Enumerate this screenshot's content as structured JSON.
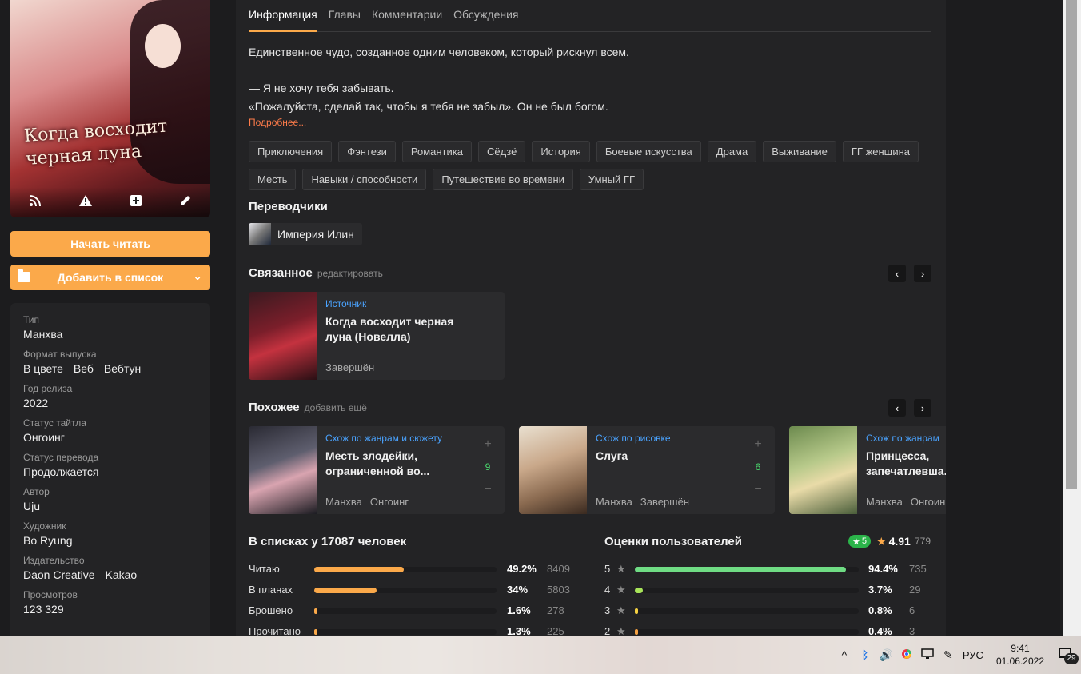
{
  "cover": {
    "title_art": "Когда восходит черная луна",
    "actions": [
      "rss-icon",
      "report-icon",
      "add-icon",
      "edit-icon"
    ]
  },
  "buttons": {
    "start_reading": "Начать читать",
    "add_to_list": "Добавить в список"
  },
  "info": [
    {
      "label": "Тип",
      "values": [
        "Манхва"
      ]
    },
    {
      "label": "Формат выпуска",
      "values": [
        "В цвете",
        "Веб",
        "Вебтун"
      ]
    },
    {
      "label": "Год релиза",
      "values": [
        "2022"
      ]
    },
    {
      "label": "Статус тайтла",
      "values": [
        "Онгоинг"
      ]
    },
    {
      "label": "Статус перевода",
      "values": [
        "Продолжается"
      ]
    },
    {
      "label": "Автор",
      "values": [
        "Uju"
      ]
    },
    {
      "label": "Художник",
      "values": [
        "Bo Ryung"
      ]
    },
    {
      "label": "Издательство",
      "values": [
        "Daon Creative",
        "Kakao"
      ]
    },
    {
      "label": "Просмотров",
      "values": [
        "123 329"
      ]
    }
  ],
  "tabs": [
    "Информация",
    "Главы",
    "Комментарии",
    "Обсуждения"
  ],
  "active_tab": 0,
  "description": {
    "lines": [
      "Единственное чудо, созданное одним человеком, который рискнул всем.",
      "",
      "— Я не хочу тебя забывать.",
      "«Пожалуйста, сделай так, чтобы я тебя не забыл». Он не был богом."
    ],
    "more": "Подробнее..."
  },
  "tags": [
    "Приключения",
    "Фэнтези",
    "Романтика",
    "Сёдзё",
    "История",
    "Боевые искусства",
    "Драма",
    "Выживание",
    "ГГ женщина",
    "Месть",
    "Навыки / способности",
    "Путешествие во времени",
    "Умный ГГ"
  ],
  "translators": {
    "title": "Переводчики",
    "items": [
      {
        "name": "Империя Илин"
      }
    ]
  },
  "related": {
    "title": "Связанное",
    "sub": "редактировать",
    "items": [
      {
        "relation": "Источник",
        "title": "Когда восходит черная луна (Новелла)",
        "meta": [
          "Завершён"
        ]
      }
    ]
  },
  "similar": {
    "title": "Похожее",
    "sub": "добавить ещё",
    "items": [
      {
        "relation": "Схож по жанрам и сюжету",
        "title": "Месть злодейки, ограниченной во...",
        "meta": [
          "Манхва",
          "Онгоинг"
        ],
        "votes": "9"
      },
      {
        "relation": "Схож по рисовке",
        "title": "Слуга",
        "meta": [
          "Манхва",
          "Завершён"
        ],
        "votes": "6"
      },
      {
        "relation": "Схож по жанрам",
        "title": "Принцесса, запечатлевша...",
        "meta": [
          "Манхва",
          "Онгоинг"
        ],
        "votes": ""
      }
    ]
  },
  "lists": {
    "title": "В списках у 17087 человек",
    "rows": [
      {
        "label": "Читаю",
        "pct": "49.2%",
        "count": "8409",
        "fraction": 0.492
      },
      {
        "label": "В планах",
        "pct": "34%",
        "count": "5803",
        "fraction": 0.34
      },
      {
        "label": "Брошено",
        "pct": "1.6%",
        "count": "278",
        "fraction": 0.016
      },
      {
        "label": "Прочитано",
        "pct": "1.3%",
        "count": "225",
        "fraction": 0.013
      }
    ],
    "color": "#fba94a"
  },
  "ratings": {
    "title": "Оценки пользователей",
    "badge": "5",
    "average": "4.91",
    "count": "779",
    "rows": [
      {
        "label": "5",
        "pct": "94.4%",
        "count": "735",
        "fraction": 0.944,
        "color": "#6fdc84"
      },
      {
        "label": "4",
        "pct": "3.7%",
        "count": "29",
        "fraction": 0.037,
        "color": "#a8e45a"
      },
      {
        "label": "3",
        "pct": "0.8%",
        "count": "6",
        "fraction": 0.008,
        "color": "#f5d142"
      },
      {
        "label": "2",
        "pct": "0.4%",
        "count": "3",
        "fraction": 0.004,
        "color": "#f5a142"
      }
    ]
  },
  "taskbar": {
    "lang": "РУС",
    "time": "9:41",
    "date": "01.06.2022",
    "notifications": "29"
  }
}
